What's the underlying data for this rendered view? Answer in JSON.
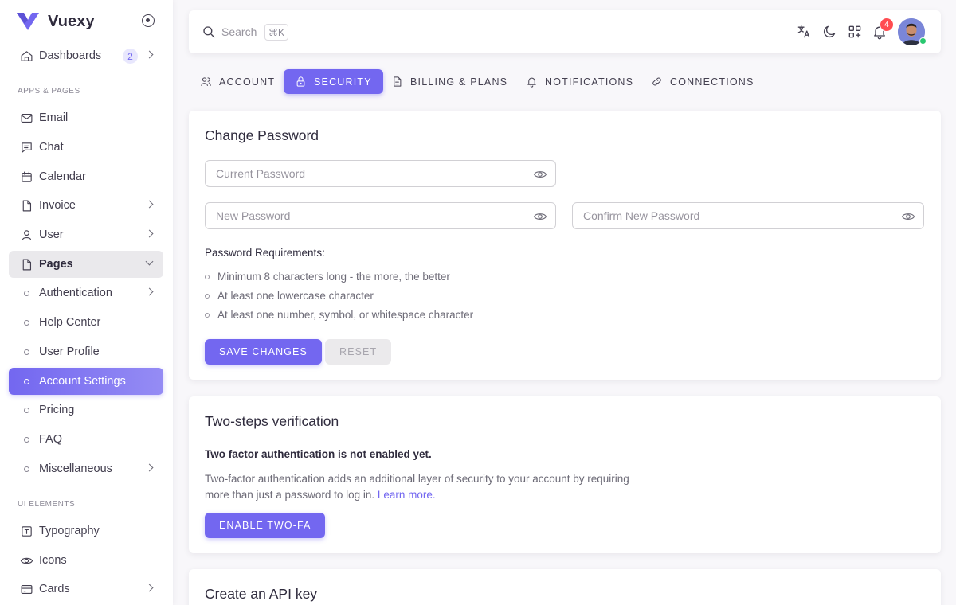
{
  "app": {
    "name": "Vuexy",
    "accent": "#7367f0"
  },
  "sidebar": {
    "dashboards": {
      "label": "Dashboards",
      "count": "2"
    },
    "section_apps": "APPS & PAGES",
    "items": [
      {
        "label": "Email",
        "icon": "mail-icon"
      },
      {
        "label": "Chat",
        "icon": "chat-icon"
      },
      {
        "label": "Calendar",
        "icon": "calendar-icon"
      },
      {
        "label": "Invoice",
        "icon": "file-icon"
      },
      {
        "label": "User",
        "icon": "user-icon"
      },
      {
        "label": "Pages",
        "icon": "file-icon"
      }
    ],
    "pages_sub": [
      {
        "label": "Authentication"
      },
      {
        "label": "Help Center"
      },
      {
        "label": "User Profile"
      },
      {
        "label": "Account Settings"
      },
      {
        "label": "Pricing"
      },
      {
        "label": "FAQ"
      },
      {
        "label": "Miscellaneous"
      }
    ],
    "section_ui": "UI ELEMENTS",
    "ui_items": [
      {
        "label": "Typography",
        "icon": "typography-icon"
      },
      {
        "label": "Icons",
        "icon": "eye-icon"
      },
      {
        "label": "Cards",
        "icon": "card-icon"
      }
    ]
  },
  "topbar": {
    "search_placeholder": "Search",
    "search_shortcut": "⌘K",
    "notification_count": "4"
  },
  "tabs": [
    {
      "label": "Account"
    },
    {
      "label": "Security"
    },
    {
      "label": "Billing & Plans"
    },
    {
      "label": "Notifications"
    },
    {
      "label": "Connections"
    }
  ],
  "change_password": {
    "title": "Change Password",
    "current_placeholder": "Current Password",
    "new_placeholder": "New Password",
    "confirm_placeholder": "Confirm New Password",
    "requirements_title": "Password Requirements:",
    "requirements": [
      "Minimum 8 characters long - the more, the better",
      "At least one lowercase character",
      "At least one number, symbol, or whitespace character"
    ],
    "save_label": "Save Changes",
    "reset_label": "Reset"
  },
  "two_step": {
    "title": "Two-steps verification",
    "heading": "Two factor authentication is not enabled yet.",
    "description": "Two-factor authentication adds an additional layer of security to your account by requiring more than just a password to log in.",
    "learn_more": "Learn more.",
    "button_label": "Enable Two-FA"
  },
  "api_key": {
    "title": "Create an API key"
  }
}
